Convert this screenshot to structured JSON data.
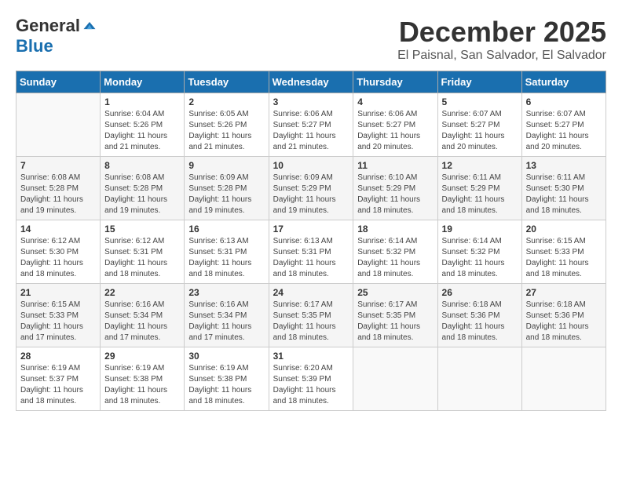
{
  "logo": {
    "general": "General",
    "blue": "Blue"
  },
  "title": "December 2025",
  "location": "El Paisnal, San Salvador, El Salvador",
  "days_of_week": [
    "Sunday",
    "Monday",
    "Tuesday",
    "Wednesday",
    "Thursday",
    "Friday",
    "Saturday"
  ],
  "weeks": [
    [
      {
        "day": "",
        "sunrise": "",
        "sunset": "",
        "daylight": ""
      },
      {
        "day": "1",
        "sunrise": "Sunrise: 6:04 AM",
        "sunset": "Sunset: 5:26 PM",
        "daylight": "Daylight: 11 hours and 21 minutes."
      },
      {
        "day": "2",
        "sunrise": "Sunrise: 6:05 AM",
        "sunset": "Sunset: 5:26 PM",
        "daylight": "Daylight: 11 hours and 21 minutes."
      },
      {
        "day": "3",
        "sunrise": "Sunrise: 6:06 AM",
        "sunset": "Sunset: 5:27 PM",
        "daylight": "Daylight: 11 hours and 21 minutes."
      },
      {
        "day": "4",
        "sunrise": "Sunrise: 6:06 AM",
        "sunset": "Sunset: 5:27 PM",
        "daylight": "Daylight: 11 hours and 20 minutes."
      },
      {
        "day": "5",
        "sunrise": "Sunrise: 6:07 AM",
        "sunset": "Sunset: 5:27 PM",
        "daylight": "Daylight: 11 hours and 20 minutes."
      },
      {
        "day": "6",
        "sunrise": "Sunrise: 6:07 AM",
        "sunset": "Sunset: 5:27 PM",
        "daylight": "Daylight: 11 hours and 20 minutes."
      }
    ],
    [
      {
        "day": "7",
        "sunrise": "Sunrise: 6:08 AM",
        "sunset": "Sunset: 5:28 PM",
        "daylight": "Daylight: 11 hours and 19 minutes."
      },
      {
        "day": "8",
        "sunrise": "Sunrise: 6:08 AM",
        "sunset": "Sunset: 5:28 PM",
        "daylight": "Daylight: 11 hours and 19 minutes."
      },
      {
        "day": "9",
        "sunrise": "Sunrise: 6:09 AM",
        "sunset": "Sunset: 5:28 PM",
        "daylight": "Daylight: 11 hours and 19 minutes."
      },
      {
        "day": "10",
        "sunrise": "Sunrise: 6:09 AM",
        "sunset": "Sunset: 5:29 PM",
        "daylight": "Daylight: 11 hours and 19 minutes."
      },
      {
        "day": "11",
        "sunrise": "Sunrise: 6:10 AM",
        "sunset": "Sunset: 5:29 PM",
        "daylight": "Daylight: 11 hours and 18 minutes."
      },
      {
        "day": "12",
        "sunrise": "Sunrise: 6:11 AM",
        "sunset": "Sunset: 5:29 PM",
        "daylight": "Daylight: 11 hours and 18 minutes."
      },
      {
        "day": "13",
        "sunrise": "Sunrise: 6:11 AM",
        "sunset": "Sunset: 5:30 PM",
        "daylight": "Daylight: 11 hours and 18 minutes."
      }
    ],
    [
      {
        "day": "14",
        "sunrise": "Sunrise: 6:12 AM",
        "sunset": "Sunset: 5:30 PM",
        "daylight": "Daylight: 11 hours and 18 minutes."
      },
      {
        "day": "15",
        "sunrise": "Sunrise: 6:12 AM",
        "sunset": "Sunset: 5:31 PM",
        "daylight": "Daylight: 11 hours and 18 minutes."
      },
      {
        "day": "16",
        "sunrise": "Sunrise: 6:13 AM",
        "sunset": "Sunset: 5:31 PM",
        "daylight": "Daylight: 11 hours and 18 minutes."
      },
      {
        "day": "17",
        "sunrise": "Sunrise: 6:13 AM",
        "sunset": "Sunset: 5:31 PM",
        "daylight": "Daylight: 11 hours and 18 minutes."
      },
      {
        "day": "18",
        "sunrise": "Sunrise: 6:14 AM",
        "sunset": "Sunset: 5:32 PM",
        "daylight": "Daylight: 11 hours and 18 minutes."
      },
      {
        "day": "19",
        "sunrise": "Sunrise: 6:14 AM",
        "sunset": "Sunset: 5:32 PM",
        "daylight": "Daylight: 11 hours and 18 minutes."
      },
      {
        "day": "20",
        "sunrise": "Sunrise: 6:15 AM",
        "sunset": "Sunset: 5:33 PM",
        "daylight": "Daylight: 11 hours and 18 minutes."
      }
    ],
    [
      {
        "day": "21",
        "sunrise": "Sunrise: 6:15 AM",
        "sunset": "Sunset: 5:33 PM",
        "daylight": "Daylight: 11 hours and 17 minutes."
      },
      {
        "day": "22",
        "sunrise": "Sunrise: 6:16 AM",
        "sunset": "Sunset: 5:34 PM",
        "daylight": "Daylight: 11 hours and 17 minutes."
      },
      {
        "day": "23",
        "sunrise": "Sunrise: 6:16 AM",
        "sunset": "Sunset: 5:34 PM",
        "daylight": "Daylight: 11 hours and 17 minutes."
      },
      {
        "day": "24",
        "sunrise": "Sunrise: 6:17 AM",
        "sunset": "Sunset: 5:35 PM",
        "daylight": "Daylight: 11 hours and 18 minutes."
      },
      {
        "day": "25",
        "sunrise": "Sunrise: 6:17 AM",
        "sunset": "Sunset: 5:35 PM",
        "daylight": "Daylight: 11 hours and 18 minutes."
      },
      {
        "day": "26",
        "sunrise": "Sunrise: 6:18 AM",
        "sunset": "Sunset: 5:36 PM",
        "daylight": "Daylight: 11 hours and 18 minutes."
      },
      {
        "day": "27",
        "sunrise": "Sunrise: 6:18 AM",
        "sunset": "Sunset: 5:36 PM",
        "daylight": "Daylight: 11 hours and 18 minutes."
      }
    ],
    [
      {
        "day": "28",
        "sunrise": "Sunrise: 6:19 AM",
        "sunset": "Sunset: 5:37 PM",
        "daylight": "Daylight: 11 hours and 18 minutes."
      },
      {
        "day": "29",
        "sunrise": "Sunrise: 6:19 AM",
        "sunset": "Sunset: 5:38 PM",
        "daylight": "Daylight: 11 hours and 18 minutes."
      },
      {
        "day": "30",
        "sunrise": "Sunrise: 6:19 AM",
        "sunset": "Sunset: 5:38 PM",
        "daylight": "Daylight: 11 hours and 18 minutes."
      },
      {
        "day": "31",
        "sunrise": "Sunrise: 6:20 AM",
        "sunset": "Sunset: 5:39 PM",
        "daylight": "Daylight: 11 hours and 18 minutes."
      },
      {
        "day": "",
        "sunrise": "",
        "sunset": "",
        "daylight": ""
      },
      {
        "day": "",
        "sunrise": "",
        "sunset": "",
        "daylight": ""
      },
      {
        "day": "",
        "sunrise": "",
        "sunset": "",
        "daylight": ""
      }
    ]
  ]
}
